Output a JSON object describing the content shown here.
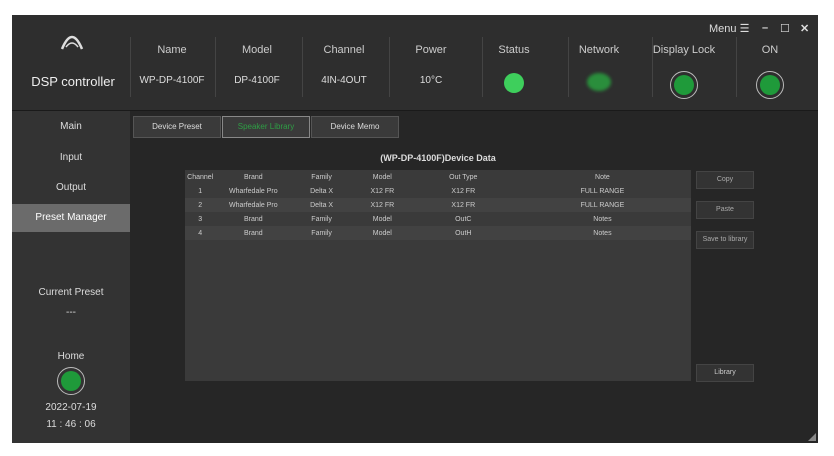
{
  "app": {
    "title": "DSP controller",
    "logo_text": "DSP"
  },
  "window": {
    "menu_label": "Menu ☰",
    "minimize": "–",
    "maximize": "☐",
    "close": "✕"
  },
  "header": {
    "name": {
      "label": "Name",
      "value": "WP-DP-4100F"
    },
    "model": {
      "label": "Model",
      "value": "DP-4100F"
    },
    "channel": {
      "label": "Channel",
      "value": "4IN-4OUT"
    },
    "power": {
      "label": "Power",
      "value": "10°C"
    },
    "status": {
      "label": "Status"
    },
    "network": {
      "label": "Network"
    },
    "display_lock": {
      "label": "Display Lock"
    },
    "on": {
      "label": "ON"
    }
  },
  "colors": {
    "green": "#3ecf5c",
    "dark_green": "#1f9a3a"
  },
  "sidebar": {
    "items": [
      {
        "label": "Main"
      },
      {
        "label": "Input"
      },
      {
        "label": "Output"
      },
      {
        "label": "Preset Manager"
      }
    ],
    "current_preset_label": "Current Preset",
    "current_preset_value": "---",
    "home_label": "Home",
    "date": "2022-07-19",
    "time": "11 : 46 : 06"
  },
  "tabs": [
    {
      "label": "Device Preset"
    },
    {
      "label": "Speaker Library"
    },
    {
      "label": "Device Memo"
    }
  ],
  "table": {
    "title": "(WP-DP-4100F)Device Data",
    "headers": [
      "Channel",
      "Brand",
      "Family",
      "Model",
      "Out Type",
      "Note"
    ],
    "rows": [
      [
        "1",
        "Wharfedale Pro",
        "Delta X",
        "X12 FR",
        "X12 FR",
        "FULL RANGE"
      ],
      [
        "2",
        "Wharfedale Pro",
        "Delta X",
        "X12 FR",
        "X12 FR",
        "FULL RANGE"
      ],
      [
        "3",
        "Brand",
        "Family",
        "Model",
        "OutC",
        "Notes"
      ],
      [
        "4",
        "Brand",
        "Family",
        "Model",
        "OutH",
        "Notes"
      ]
    ]
  },
  "buttons": {
    "copy": "Copy",
    "paste": "Paste",
    "save": "Save to library",
    "library": "Library"
  }
}
